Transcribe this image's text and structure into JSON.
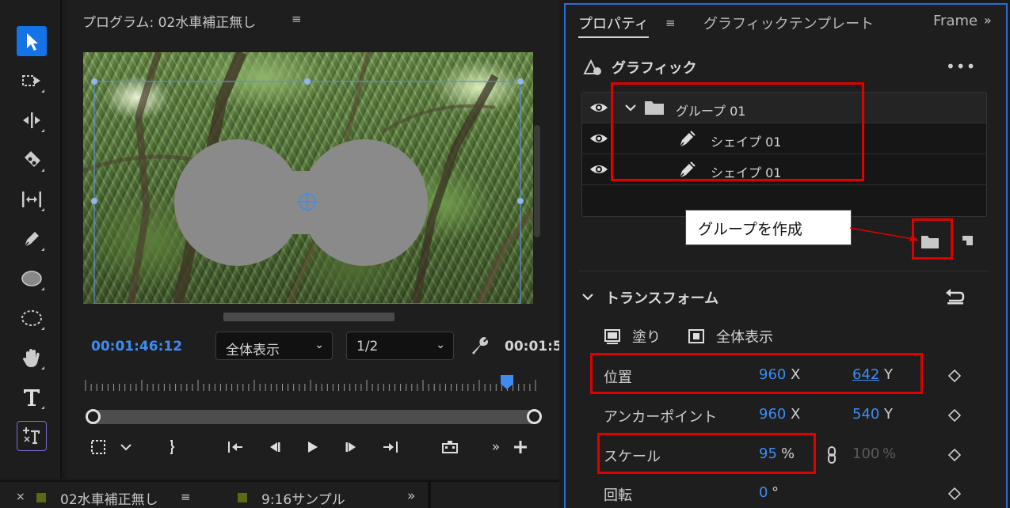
{
  "toolbar": {
    "tools": [
      "selection-tool",
      "track-select-forward-tool",
      "ripple-edit-tool",
      "razor-tool",
      "slip-tool",
      "pen-tool",
      "rectangle-tool",
      "ellipse-tool",
      "hand-tool",
      "type-tool",
      "vertical-type-tool"
    ]
  },
  "program": {
    "title": "プログラム: 02水車補正無し",
    "menu_icon": "≡",
    "timecode": "00:01:46:12",
    "zoom_select": "全体表示",
    "resolution_select": "1/2",
    "end_timecode": "00:01:5",
    "playhead_position": 0.93
  },
  "bottom_tabs": [
    {
      "label": "02水車補正無し",
      "menu": "≡",
      "close": "×"
    },
    {
      "label": "9:16サンプル"
    }
  ],
  "bottom_overflow": "»",
  "properties": {
    "tabs": {
      "properties": "プロパティ",
      "menu": "≡",
      "graphic_templates": "グラフィックテンプレート",
      "frame": "Frame",
      "overflow": "»"
    },
    "graphic": {
      "title": "グラフィック",
      "more": "•••",
      "layers": [
        {
          "label": "グループ 01",
          "type": "group"
        },
        {
          "label": "シェイプ 01",
          "type": "shape"
        },
        {
          "label": "シェイプ 01",
          "type": "shape"
        }
      ]
    },
    "callout": "グループを作成",
    "transform": {
      "title": "トランスフォーム",
      "fill_label": "塗り",
      "fit_label": "全体表示",
      "rows": {
        "position": {
          "name": "位置",
          "x": "960",
          "x_unit": "X",
          "y": "642",
          "y_unit": "Y"
        },
        "anchor": {
          "name": "アンカーポイント",
          "x": "960",
          "x_unit": "X",
          "y": "540",
          "y_unit": "Y"
        },
        "scale": {
          "name": "スケール",
          "value": "95",
          "unit": "%",
          "linked_value": "100",
          "linked_unit": "%"
        },
        "rotation": {
          "name": "回転",
          "value": "0",
          "unit": "°"
        }
      }
    }
  },
  "colors": {
    "accent_blue": "#3f8cf0",
    "highlight_red": "#e00000",
    "shape_gray": "#8a8a8a"
  }
}
